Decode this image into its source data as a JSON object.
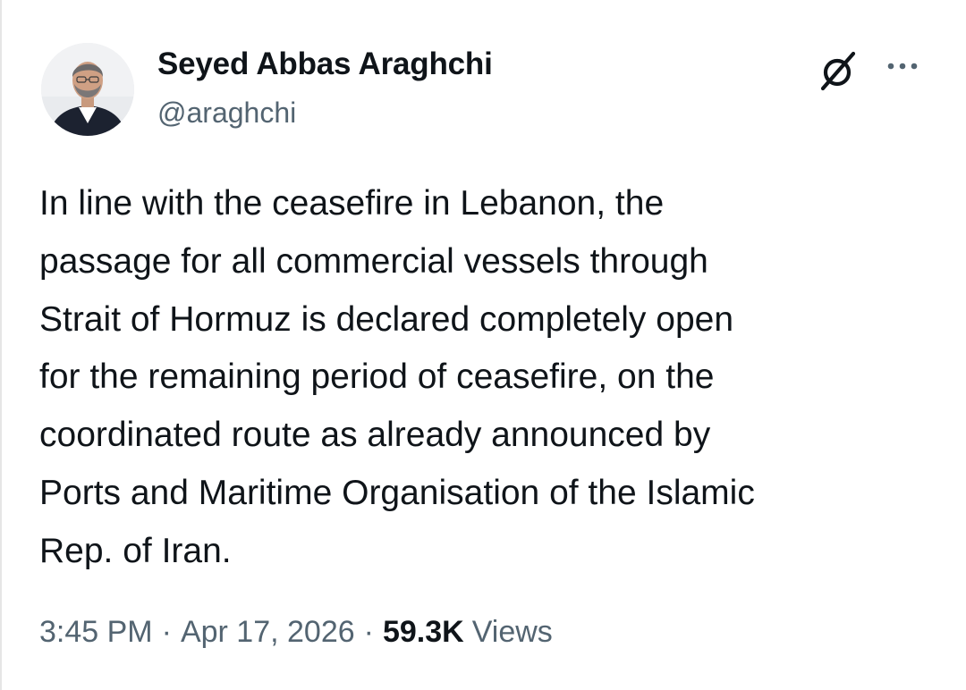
{
  "author": {
    "name": "Seyed Abbas Araghchi",
    "handle": "@araghchi",
    "avatar_icon": "profile-photo"
  },
  "header_icons": {
    "grok": "grok-icon",
    "more": "more-options-icon"
  },
  "tweet": {
    "lines": [
      "In line with the ceasefire in Lebanon, the",
      "passage for all commercial vessels through",
      "Strait of Hormuz is declared completely open",
      "for the remaining period of ceasefire, on the",
      "coordinated route as already announced by",
      "Ports and Maritime Organisation of the Islamic",
      "Rep. of Iran."
    ]
  },
  "meta": {
    "time": "3:45 PM",
    "separator": "·",
    "date": "Apr 17, 2026",
    "views_count": "59.3K",
    "views_label": "Views"
  },
  "colors": {
    "text_primary": "#0f1419",
    "text_secondary": "#536471",
    "background": "#ffffff"
  }
}
